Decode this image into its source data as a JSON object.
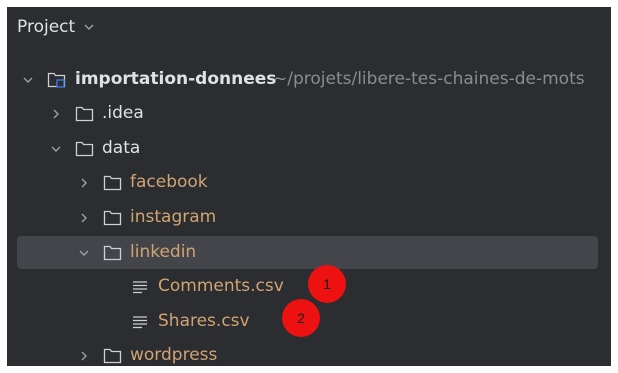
{
  "panel": {
    "title": "Project"
  },
  "tree": {
    "root": {
      "label": "importation-donnees",
      "path": "~/projets/libere-tes-chaines-de-mots"
    },
    "idea": {
      "label": ".idea"
    },
    "data": {
      "label": "data"
    },
    "facebook": {
      "label": "facebook"
    },
    "instagram": {
      "label": "instagram"
    },
    "linkedin": {
      "label": "linkedin"
    },
    "comments": {
      "label": "Comments.csv"
    },
    "shares": {
      "label": "Shares.csv"
    },
    "wordpress": {
      "label": "wordpress"
    }
  },
  "badges": {
    "one": "1",
    "two": "2"
  },
  "colors": {
    "background": "#2b2d30",
    "selection": "#43454a",
    "file_label": "#d0a472",
    "path_text": "#8a8c91",
    "badge": "#ee1111",
    "module_accent": "#3d7cf0"
  },
  "icons": {
    "header": "chevron-down-icon",
    "expanded": "chevron-down-icon",
    "collapsed": "chevron-right-icon",
    "module": "module-folder-icon",
    "folder": "folder-icon",
    "file": "text-file-icon"
  }
}
